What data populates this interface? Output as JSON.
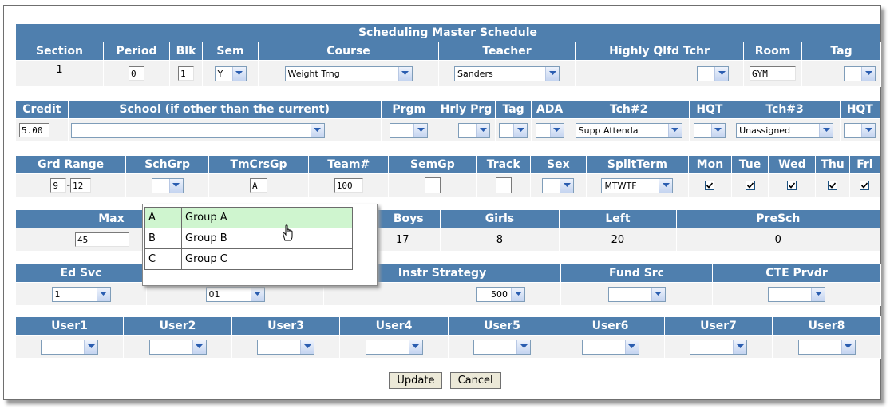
{
  "title": "Scheduling Master Schedule",
  "row1": {
    "headers": [
      "Section",
      "Period",
      "Blk",
      "Sem",
      "Course",
      "Teacher",
      "Highly Qlfd Tchr",
      "Room",
      "Tag"
    ],
    "section": "1",
    "period": "0",
    "blk": "1",
    "sem": "Y",
    "course": "Weight Trng",
    "teacher": "Sanders",
    "room": "GYM"
  },
  "row2": {
    "headers": [
      "Credit",
      "School (if other than the current)",
      "Prgm",
      "Hrly Prg",
      "Tag",
      "ADA",
      "Tch#2",
      "HQT",
      "Tch#3",
      "HQT"
    ],
    "credit": "5.00",
    "tch2": "Supp Attenda",
    "tch3": "Unassigned"
  },
  "row3": {
    "headers": [
      "Grd Range",
      "SchGrp",
      "TmCrsGp",
      "Team#",
      "SemGp",
      "Track",
      "Sex",
      "SplitTerm",
      "Mon",
      "Tue",
      "Wed",
      "Thu",
      "Fri"
    ],
    "grd_from": "9",
    "grd_sep": "-",
    "grd_to": "12",
    "tmcrsgp": "A",
    "team": "100",
    "splitterm": "MTWTF",
    "days_checked": [
      true,
      true,
      true,
      true,
      true
    ]
  },
  "row4": {
    "headers": [
      "Max",
      "Boys",
      "Girls",
      "Left",
      "PreSch"
    ],
    "max": "45",
    "boys": "17",
    "girls": "8",
    "left": "20",
    "presch": "0"
  },
  "row5": {
    "headers": [
      "Ed Svc",
      "Instr Strategy",
      "Fund Src",
      "CTE Prvdr"
    ],
    "ed_svc": "1",
    "second": "01",
    "instr_strategy": "500"
  },
  "row6": {
    "headers": [
      "User1",
      "User2",
      "User3",
      "User4",
      "User5",
      "User6",
      "User7",
      "User8"
    ]
  },
  "buttons": {
    "update": "Update",
    "cancel": "Cancel"
  },
  "schgrp_popup": {
    "options": [
      {
        "code": "A",
        "label": "Group A",
        "highlighted": true
      },
      {
        "code": "B",
        "label": "Group B",
        "highlighted": false
      },
      {
        "code": "C",
        "label": "Group C",
        "highlighted": false
      }
    ]
  },
  "colors": {
    "header_bg": "#4f7fae",
    "value_bg": "#f2f2f2",
    "highlight": "#cff5cf"
  }
}
